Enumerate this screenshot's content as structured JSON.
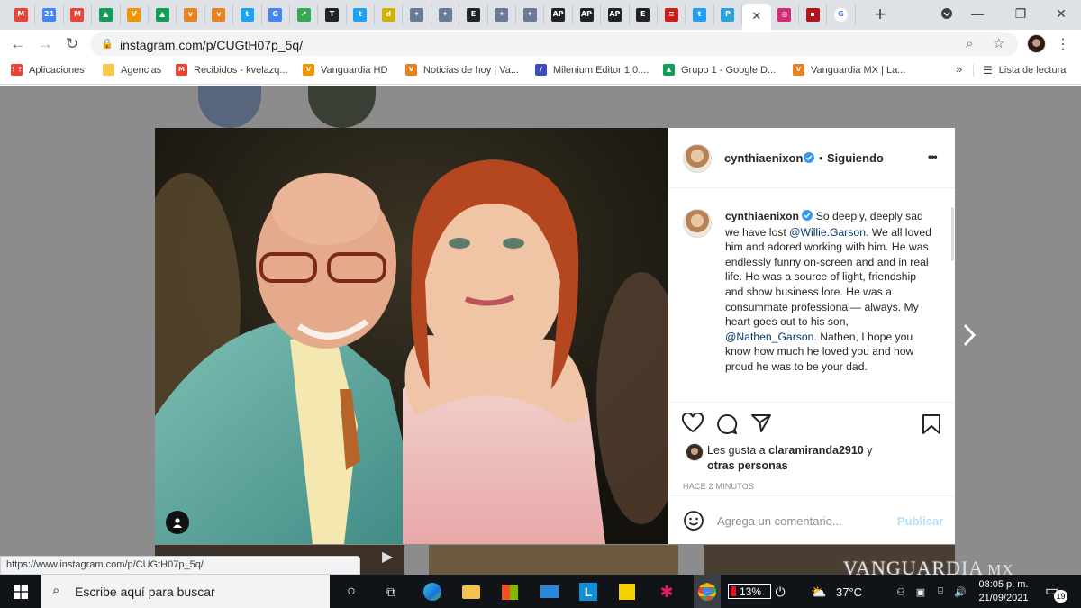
{
  "browser": {
    "url": "instagram.com/p/CUGtH07p_5q/",
    "tabs": [
      {
        "icon": "gmail-icon",
        "glyph": "M",
        "color": "#ea4335"
      },
      {
        "icon": "calendar-icon",
        "glyph": "21",
        "color": "#4285f4"
      },
      {
        "icon": "gmail-icon",
        "glyph": "M",
        "color": "#ea4335"
      },
      {
        "icon": "drive-icon",
        "glyph": "▲",
        "color": "#0f9d58"
      },
      {
        "icon": "vanguardia-icon",
        "glyph": "V",
        "color": "#f29400"
      },
      {
        "icon": "drive-icon",
        "glyph": "▲",
        "color": "#0f9d58"
      },
      {
        "icon": "vanguardia-icon",
        "glyph": "v",
        "color": "#e8821e"
      },
      {
        "icon": "vanguardia-icon",
        "glyph": "v",
        "color": "#e8821e"
      },
      {
        "icon": "twitter-icon",
        "glyph": "t",
        "color": "#1da1f2"
      },
      {
        "icon": "news-icon",
        "glyph": "G",
        "color": "#4285f4"
      },
      {
        "icon": "trends-icon",
        "glyph": "↗",
        "color": "#34a853"
      },
      {
        "icon": "nyt-icon",
        "glyph": "T",
        "color": "#222222"
      },
      {
        "icon": "twitter-icon",
        "glyph": "t",
        "color": "#1da1f2"
      },
      {
        "icon": "d-icon",
        "glyph": "d",
        "color": "#d4b000"
      },
      {
        "icon": "site-icon",
        "glyph": "✦",
        "color": "#6a7a96"
      },
      {
        "icon": "site-icon",
        "glyph": "✦",
        "color": "#6a7a96"
      },
      {
        "icon": "e-icon",
        "glyph": "E",
        "color": "#222222"
      },
      {
        "icon": "site-icon",
        "glyph": "✦",
        "color": "#6a7a96"
      },
      {
        "icon": "site-icon",
        "glyph": "✦",
        "color": "#6a7a96"
      },
      {
        "icon": "ap-icon",
        "glyph": "AP",
        "color": "#222222"
      },
      {
        "icon": "ap-icon",
        "glyph": "AP",
        "color": "#222222"
      },
      {
        "icon": "ap-icon",
        "glyph": "AP",
        "color": "#222222"
      },
      {
        "icon": "e-icon",
        "glyph": "E",
        "color": "#222222"
      },
      {
        "icon": "red-icon",
        "glyph": "≡",
        "color": "#d11a1a"
      },
      {
        "icon": "twitter-icon",
        "glyph": "t",
        "color": "#1da1f2"
      },
      {
        "icon": "p-icon",
        "glyph": "P",
        "color": "#2aa3d9"
      },
      {
        "icon": "close-icon",
        "glyph": "✕",
        "color": "#ffffff",
        "active": true
      },
      {
        "icon": "instagram-icon",
        "glyph": "◎",
        "color": "#d62976"
      },
      {
        "icon": "imdb-icon",
        "glyph": "▪",
        "color": "#b5121b"
      },
      {
        "icon": "google-icon",
        "glyph": "G",
        "color": "#ffffff"
      }
    ],
    "bookmarks": [
      {
        "label": "Aplicaciones",
        "icon": "apps-icon",
        "glyph": "⋮⋮",
        "color": "#ea4335"
      },
      {
        "label": "Agencias",
        "icon": "folder-icon",
        "glyph": "",
        "color": "#f6c94c"
      },
      {
        "label": "Recibidos - kvelazq...",
        "icon": "gmail-icon",
        "glyph": "M",
        "color": "#ea4335"
      },
      {
        "label": "Vanguardia HD",
        "icon": "vanguardia-icon",
        "glyph": "V",
        "color": "#f29400"
      },
      {
        "label": "Noticias de hoy | Va...",
        "icon": "vanguardia-icon",
        "glyph": "V",
        "color": "#e8821e"
      },
      {
        "label": "Milenium Editor 1.0....",
        "icon": "milenium-icon",
        "glyph": "/",
        "color": "#3b4cc0"
      },
      {
        "label": "Grupo 1 - Google D...",
        "icon": "drive-icon",
        "glyph": "▲",
        "color": "#0f9d58"
      },
      {
        "label": "Vanguardia MX | La...",
        "icon": "vanguardia-icon",
        "glyph": "V",
        "color": "#e8821e"
      }
    ],
    "more_bookmarks": "»",
    "reading_list": "Lista de lectura",
    "status_url": "https://www.instagram.com/p/CUGtH07p_5q/"
  },
  "post": {
    "username": "cynthiaenixon",
    "follow_status": "Siguiendo",
    "dot_separator": "•",
    "more_glyph": "•••",
    "caption": {
      "username": "cynthiaenixon",
      "text_1": "So deeply, deeply sad we have lost",
      "mention_1": "@Willie.Garson",
      "text_2": ". We all loved him and adored working with him. He was endlessly funny on-screen and and in real life. He was a source of light, friendship and show business lore. He was a consummate professional— always. My heart goes out to his son,",
      "mention_2": "@Nathen_Garson",
      "text_3": ". Nathen, I hope you know how much he loved you and how proud he was to be your dad."
    },
    "likes_prefix": "Les gusta a",
    "liked_by_user": "claramiranda2910",
    "likes_conjunction": "y",
    "likes_others": "otras personas",
    "timestamp": "HACE 2 MINUTOS",
    "comment_placeholder": "Agrega un comentario...",
    "publish_label": "Publicar"
  },
  "watermark": {
    "brand": "VANGUARDIA",
    "suffix": "MX"
  },
  "taskbar": {
    "search_placeholder": "Escribe aquí para buscar",
    "battery": "13%",
    "temperature": "37°C",
    "time": "08:05 p. m.",
    "date": "21/09/2021",
    "notifications": "19"
  }
}
